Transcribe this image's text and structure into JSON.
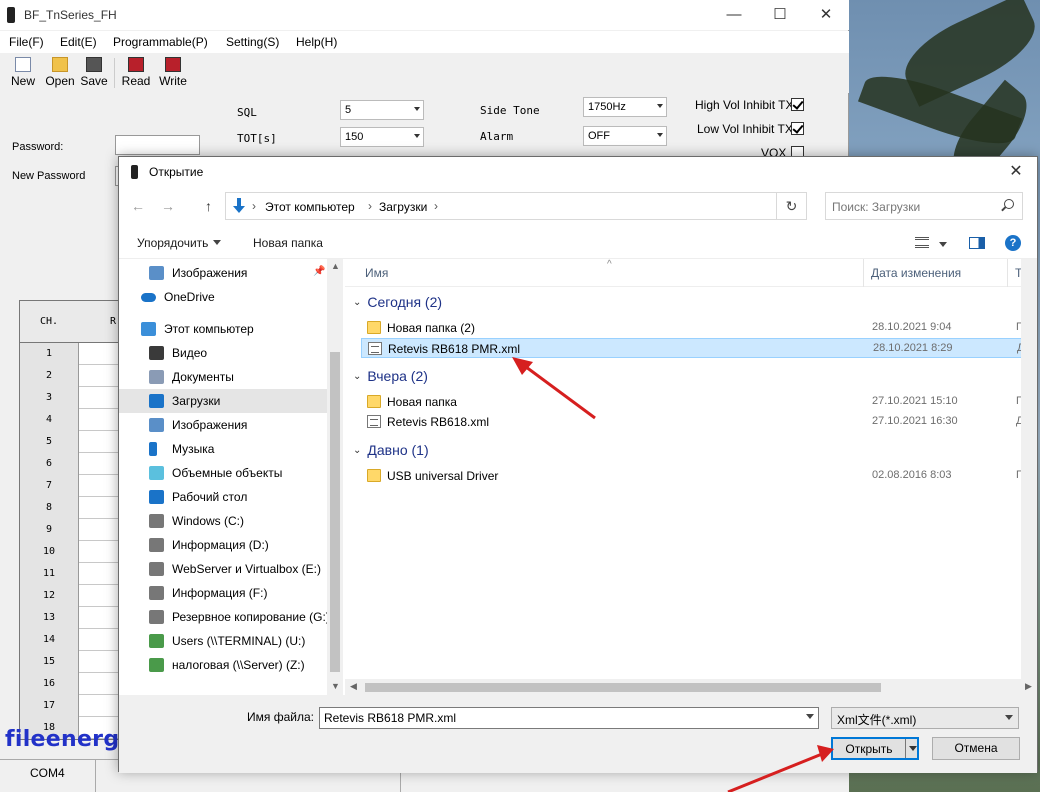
{
  "app": {
    "title": "BF_TnSeries_FH",
    "window_controls": {
      "minimize": "—",
      "maximize": "☐",
      "close": "✕"
    },
    "menu": [
      "File(F)",
      "Edit(E)",
      "Programmable(P)",
      "Setting(S)",
      "Help(H)"
    ],
    "toolbar": [
      "New",
      "Open",
      "Save",
      "Read",
      "Write"
    ],
    "params": {
      "sql_label": "SQL",
      "sql_value": "5",
      "tot_label": "TOT[s]",
      "tot_value": "150",
      "side_tone_label": "Side Tone",
      "side_tone_value": "1750Hz",
      "alarm_label": "Alarm",
      "alarm_value": "OFF"
    },
    "checkboxes": [
      {
        "label": "High Vol Inhibit TX",
        "checked": true
      },
      {
        "label": "Low Vol Inhibit TX",
        "checked": true
      },
      {
        "label": "VOX",
        "checked": false
      }
    ],
    "password_label": "Password:",
    "new_password_label": "New Password",
    "grid": {
      "col_ch": "CH.",
      "col_r": "R",
      "rows": [
        "1",
        "2",
        "3",
        "4",
        "5",
        "6",
        "7",
        "8",
        "9",
        "10",
        "11",
        "12",
        "13",
        "14",
        "15",
        "16",
        "17",
        "18"
      ]
    },
    "statusbar": {
      "port": "COM4"
    }
  },
  "watermark": "fileenergy.com",
  "dialog": {
    "title": "Открытие",
    "close": "✕",
    "nav": {
      "back": "←",
      "forward": "→",
      "up": "↑",
      "refresh": "↻"
    },
    "breadcrumb": [
      "Этот компьютер",
      "Загрузки"
    ],
    "search_placeholder": "Поиск: Загрузки",
    "organize": "Упорядочить",
    "new_folder": "Новая папка",
    "help": "?",
    "sidebar": [
      {
        "label": "Изображения",
        "icon": "pictures-icon",
        "pinned": true
      },
      {
        "label": "OneDrive",
        "icon": "onedrive-icon"
      },
      {
        "label": "Этот компьютер",
        "icon": "computer-icon"
      },
      {
        "label": "Видео",
        "icon": "video-icon"
      },
      {
        "label": "Документы",
        "icon": "documents-icon"
      },
      {
        "label": "Загрузки",
        "icon": "downloads-icon",
        "selected": true
      },
      {
        "label": "Изображения",
        "icon": "pictures-icon"
      },
      {
        "label": "Музыка",
        "icon": "music-icon"
      },
      {
        "label": "Объемные объекты",
        "icon": "3d-objects-icon"
      },
      {
        "label": "Рабочий стол",
        "icon": "desktop-icon"
      },
      {
        "label": "Windows (C:)",
        "icon": "drive-icon"
      },
      {
        "label": "Информация (D:)",
        "icon": "drive-icon"
      },
      {
        "label": "WebServer и Virtualbox (E:)",
        "icon": "drive-icon"
      },
      {
        "label": "Информация (F:)",
        "icon": "drive-icon"
      },
      {
        "label": "Резервное копирование (G:)",
        "icon": "drive-icon"
      },
      {
        "label": "Users (\\\\TERMINAL) (U:)",
        "icon": "network-drive-icon"
      },
      {
        "label": "налоговая (\\\\Server) (Z:)",
        "icon": "network-drive-icon"
      }
    ],
    "columns": {
      "name": "Имя",
      "date": "Дата изменения",
      "type": "Тип"
    },
    "groups": [
      {
        "label": "Сегодня (2)",
        "files": [
          {
            "name": "Новая папка (2)",
            "date": "28.10.2021 9:04",
            "type": "Папка",
            "kind": "folder"
          },
          {
            "name": "Retevis RB618 PMR.xml",
            "date": "28.10.2021 8:29",
            "type": "Документ",
            "kind": "xml",
            "selected": true
          }
        ]
      },
      {
        "label": "Вчера (2)",
        "files": [
          {
            "name": "Новая папка",
            "date": "27.10.2021 15:10",
            "type": "Папка",
            "kind": "folder"
          },
          {
            "name": "Retevis RB618.xml",
            "date": "27.10.2021 16:30",
            "type": "Документ",
            "kind": "xml"
          }
        ]
      },
      {
        "label": "Давно (1)",
        "files": [
          {
            "name": "USB universal Driver",
            "date": "02.08.2016 8:03",
            "type": "Папка",
            "kind": "folder"
          }
        ]
      }
    ],
    "filename_label": "Имя файла:",
    "filename_value": "Retevis RB618 PMR.xml",
    "filter_value": "Xml文件(*.xml)",
    "open_button": "Открыть",
    "cancel_button": "Отмена"
  },
  "colors": {
    "accent": "#0078d7",
    "selection": "#cce8ff",
    "annotation_arrow": "#d61f1f",
    "watermark": "#2232c8"
  }
}
